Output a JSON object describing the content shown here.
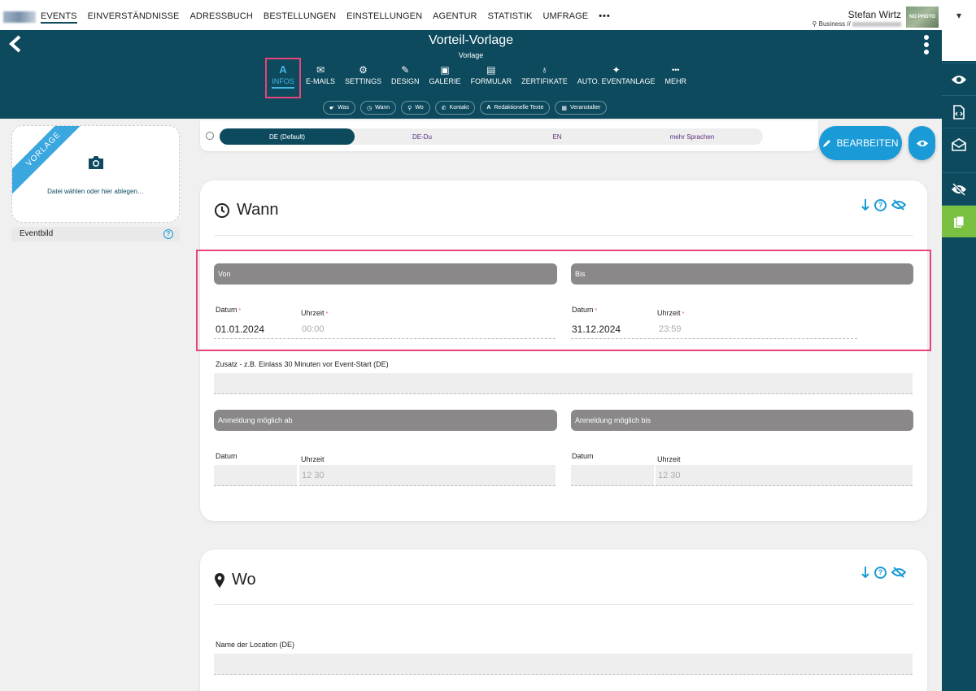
{
  "topnav": {
    "items": [
      "EVENTS",
      "EINVERSTÄNDNISSE",
      "ADRESSBUCH",
      "BESTELLUNGEN",
      "EINSTELLUNGEN",
      "AGENTUR",
      "STATISTIK",
      "UMFRAGE"
    ],
    "more": "•••",
    "user_name": "Stefan Wirtz",
    "user_sub": "Business //",
    "avatar_label": "NO PHOTO",
    "dropdown": "▾"
  },
  "header": {
    "title": "Vorteil-Vorlage",
    "subtitle": "Vorlage",
    "back_icon": "‹"
  },
  "tabs": [
    {
      "label": "INFOS",
      "icon": "A"
    },
    {
      "label": "E-MAILS",
      "icon": "✉"
    },
    {
      "label": "SETTINGS",
      "icon": "⚙"
    },
    {
      "label": "DESIGN",
      "icon": "✎"
    },
    {
      "label": "GALERIE",
      "icon": "▣"
    },
    {
      "label": "FORMULAR",
      "icon": "▤"
    },
    {
      "label": "ZERTIFIKATE",
      "icon": "♁"
    },
    {
      "label": "AUTO. EVENTANLAGE",
      "icon": "✦"
    },
    {
      "label": "MEHR",
      "icon": "•••"
    }
  ],
  "pills": [
    {
      "label": "Was",
      "icon": "☛"
    },
    {
      "label": "Wann",
      "icon": "◷"
    },
    {
      "label": "Wo",
      "icon": "⚲"
    },
    {
      "label": "Kontakt",
      "icon": "✆"
    },
    {
      "label": "Redaktionelle Texte",
      "icon": "A"
    },
    {
      "label": "Veranstalter",
      "icon": "▦"
    }
  ],
  "left": {
    "ribbon": "VORLAGE",
    "upload_text": "Datei wählen oder hier ablegen…",
    "eventbild": "Eventbild",
    "help": "?"
  },
  "languages": {
    "items": [
      "DE (Default)",
      "DE-Du",
      "EN",
      "mehr Sprachen"
    ],
    "active": "DE (Default)"
  },
  "actions": {
    "edit_label": "BEARBEITEN"
  },
  "wann": {
    "title": "Wann",
    "von": "Von",
    "bis": "Bis",
    "datum_label": "Datum",
    "uhrzeit_label": "Uhrzeit",
    "required": "*",
    "von_datum": "01.01.2024",
    "von_uhrzeit": "00:00",
    "bis_datum": "31.12.2024",
    "bis_uhrzeit": "23:59",
    "zusatz_label": "Zusatz - z.B. Einlass 30 Minuten vor Event-Start (DE)",
    "anm_ab": "Anmeldung möglich ab",
    "anm_bis": "Anmeldung möglich bis",
    "anm_ab_uhrzeit_ph": "12 30",
    "anm_bis_uhrzeit_ph": "12 30"
  },
  "wo": {
    "title": "Wo",
    "location_label": "Name der Location (DE)"
  },
  "colors": {
    "primary": "#0d4a5e",
    "accent": "#1a9ad6",
    "highlight": "#e8437a",
    "green": "#7ac142"
  }
}
